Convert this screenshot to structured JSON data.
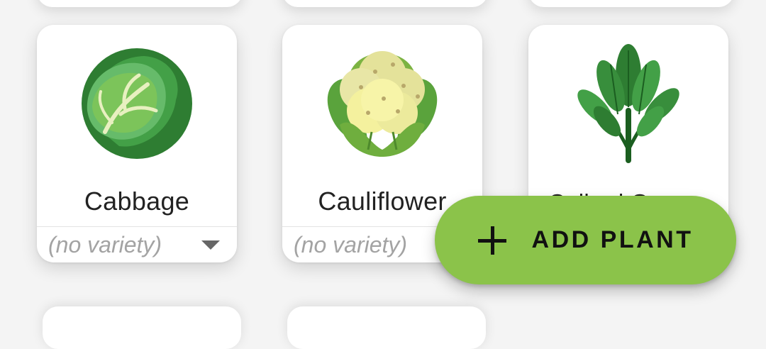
{
  "plants": [
    {
      "name": "Cabbage",
      "icon": "cabbage-icon",
      "variety": "(no variety)"
    },
    {
      "name": "Cauliflower",
      "icon": "cauliflower-icon",
      "variety": "(no variety)"
    },
    {
      "name": "Collard Greens",
      "icon": "collard-greens-icon"
    }
  ],
  "fab": {
    "label": "ADD PLANT",
    "icon": "plus-icon"
  },
  "colors": {
    "accent": "#8bc34a",
    "card": "#ffffff",
    "background": "#f4f4f4",
    "muted_text": "#a3a3a3"
  }
}
